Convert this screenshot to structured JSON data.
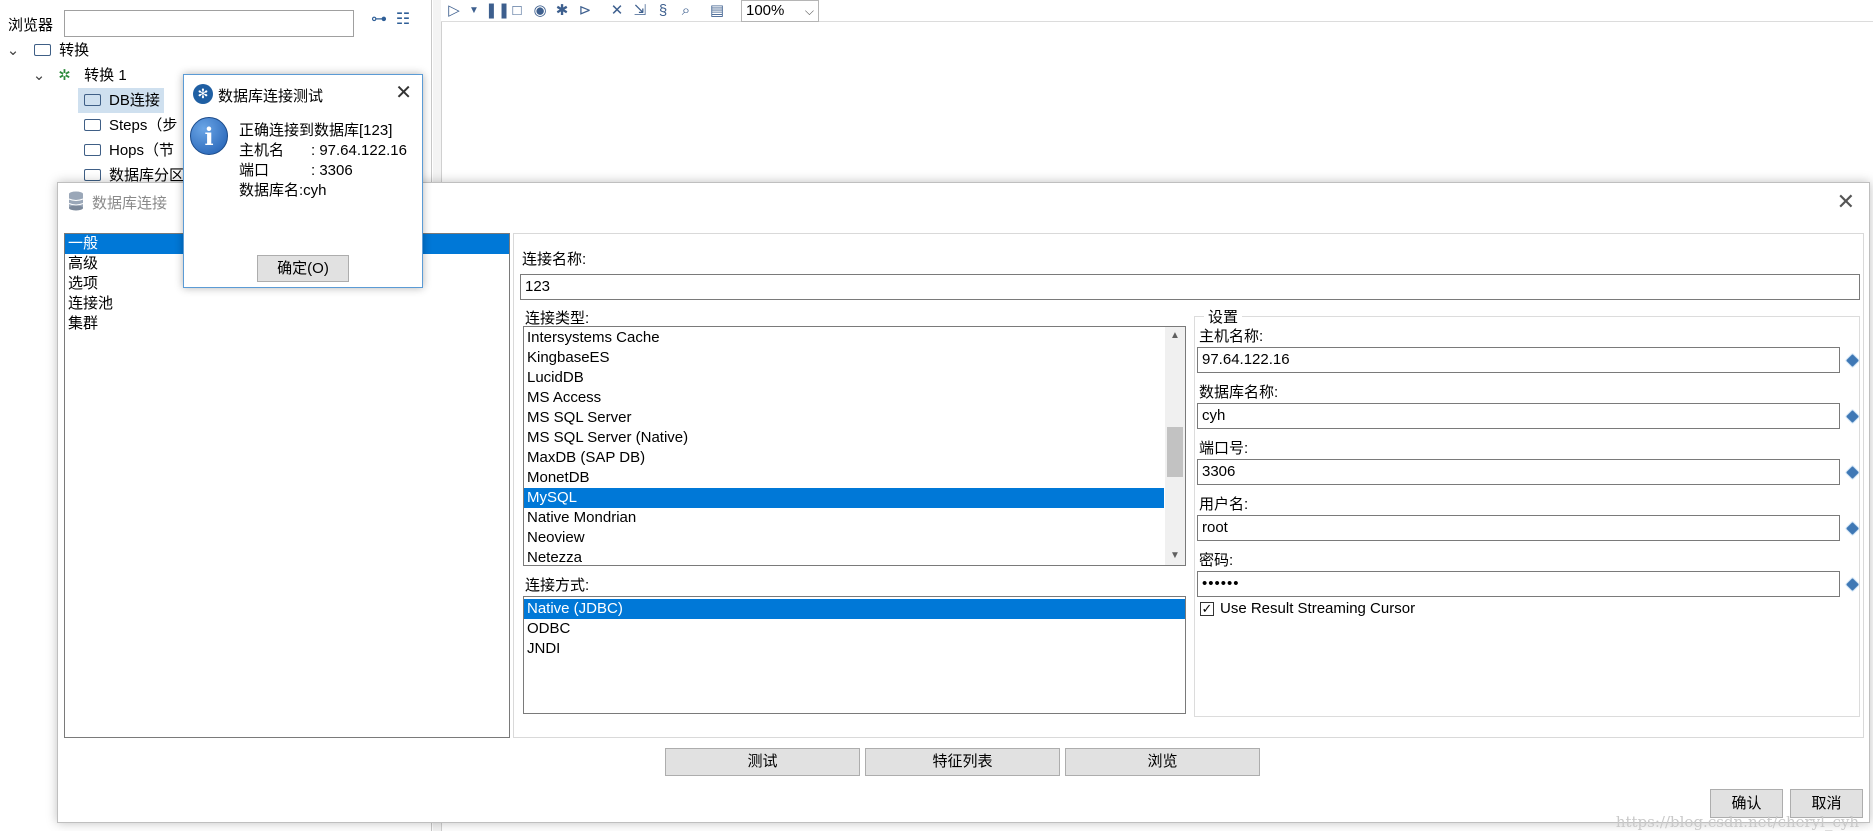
{
  "explorer": {
    "title": "浏览器",
    "search_value": "",
    "tree": [
      {
        "label": "转换",
        "level": 0
      },
      {
        "label": "转换 1",
        "level": 1
      },
      {
        "label": "DB连接",
        "level": 2
      },
      {
        "label": "Steps（步",
        "level": 2
      },
      {
        "label": "Hops（节",
        "level": 2
      },
      {
        "label": "数据库分区",
        "level": 2
      }
    ]
  },
  "canvas": {
    "zoom": "100%"
  },
  "db_dialog": {
    "title": "数据库连接",
    "categories": [
      "一般",
      "高级",
      "选项",
      "连接池",
      "集群"
    ],
    "connection_name_label": "连接名称:",
    "connection_name_value": "123",
    "connection_type_label": "连接类型:",
    "connection_types": [
      "Intersystems Cache",
      "KingbaseES",
      "LucidDB",
      "MS Access",
      "MS SQL Server",
      "MS SQL Server (Native)",
      "MaxDB (SAP DB)",
      "MonetDB",
      "MySQL",
      "Native Mondrian",
      "Neoview",
      "Netezza"
    ],
    "connection_types_selected": "MySQL",
    "access_label": "连接方式:",
    "access_methods": [
      "Native (JDBC)",
      "ODBC",
      "JNDI"
    ],
    "access_selected": "Native (JDBC)",
    "settings": {
      "group_label": "设置",
      "host_label": "主机名称:",
      "host_value": "97.64.122.16",
      "db_label": "数据库名称:",
      "db_value": "cyh",
      "port_label": "端口号:",
      "port_value": "3306",
      "user_label": "用户名:",
      "user_value": "root",
      "password_label": "密码:",
      "password_value": "••••••",
      "streaming_label": "Use Result Streaming Cursor",
      "streaming_checked": true
    },
    "buttons": {
      "test": "测试",
      "features": "特征列表",
      "explore": "浏览",
      "ok": "确认",
      "cancel": "取消"
    }
  },
  "test_dialog": {
    "title": "数据库连接测试",
    "line1": "正确连接到数据库[123]",
    "host_key": "主机名",
    "host_val": ": 97.64.122.16",
    "port_key": "端口",
    "port_val": ": 3306",
    "db_line": "数据库名:cyh",
    "ok_label": "确定(O)"
  },
  "watermark": "https://blog.csdn.net/cheryl_cyh"
}
